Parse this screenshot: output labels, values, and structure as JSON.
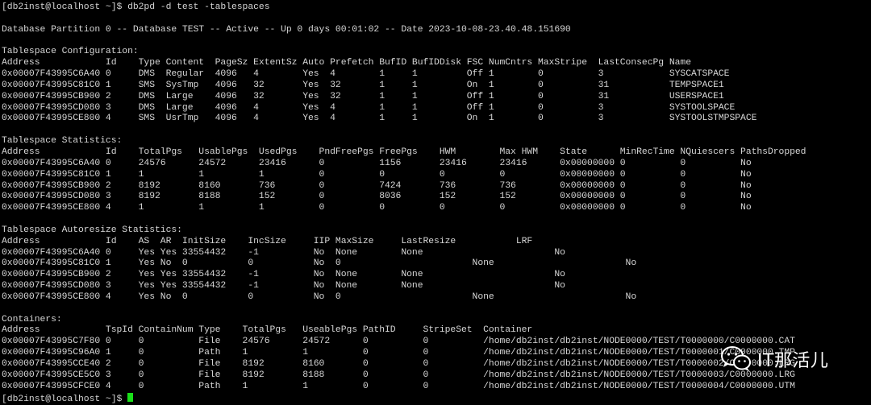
{
  "terminal": {
    "lines": [
      "[db2inst@localhost ~]$ db2pd -d test -tablespaces",
      "",
      "Database Partition 0 -- Database TEST -- Active -- Up 0 days 00:01:02 -- Date 2023-10-08-23.40.48.151690",
      "",
      "Tablespace Configuration:",
      "Address            Id    Type Content  PageSz ExtentSz Auto Prefetch BufID BufIDDisk FSC NumCntrs MaxStripe  LastConsecPg Name",
      "0x00007F43995C6A40 0     DMS  Regular  4096   4        Yes  4        1     1         Off 1        0          3            SYSCATSPACE",
      "0x00007F43995C81C0 1     SMS  SysTmp   4096   32       Yes  32       1     1         On  1        0          31           TEMPSPACE1",
      "0x00007F43995CB900 2     DMS  Large    4096   32       Yes  32       1     1         Off 1        0          31           USERSPACE1",
      "0x00007F43995CD080 3     DMS  Large    4096   4        Yes  4        1     1         Off 1        0          3            SYSTOOLSPACE",
      "0x00007F43995CE800 4     SMS  UsrTmp   4096   4        Yes  4        1     1         On  1        0          3            SYSTOOLSTMPSPACE",
      "",
      "Tablespace Statistics:",
      "Address            Id    TotalPgs   UsablePgs  UsedPgs    PndFreePgs FreePgs    HWM        Max HWM    State      MinRecTime NQuiescers PathsDropped",
      "0x00007F43995C6A40 0     24576      24572      23416      0          1156       23416      23416      0x00000000 0          0          No",
      "0x00007F43995C81C0 1     1          1          1          0          0          0          0          0x00000000 0          0          No",
      "0x00007F43995CB900 2     8192       8160       736        0          7424       736        736        0x00000000 0          0          No",
      "0x00007F43995CD080 3     8192       8188       152        0          8036       152        152        0x00000000 0          0          No",
      "0x00007F43995CE800 4     1          1          1          0          0          0          0          0x00000000 0          0          No",
      "",
      "Tablespace Autoresize Statistics:",
      "Address            Id    AS  AR  InitSize    IncSize     IIP MaxSize     LastResize           LRF",
      "0x00007F43995C6A40 0     Yes Yes 33554432    -1          No  None        None                        No",
      "0x00007F43995C81C0 1     Yes No  0           0           No  0                        None                        No",
      "0x00007F43995CB900 2     Yes Yes 33554432    -1          No  None        None                        No",
      "0x00007F43995CD080 3     Yes Yes 33554432    -1          No  None        None                        No",
      "0x00007F43995CE800 4     Yes No  0           0           No  0                        None                        No",
      "",
      "Containers:",
      "Address            TspId ContainNum Type    TotalPgs   UseablePgs PathID     StripeSet  Container",
      "0x00007F43995C7F80 0     0          File    24576      24572      0          0          /home/db2inst/db2inst/NODE0000/TEST/T0000000/C0000000.CAT",
      "0x00007F43995C96A0 1     0          Path    1          1          0          0          /home/db2inst/db2inst/NODE0000/TEST/T0000001/C0000000.TMP",
      "0x00007F43995CCE40 2     0          File    8192       8160       0          0          /home/db2inst/db2inst/NODE0000/TEST/T0000002/C0000000.LRG",
      "0x00007F43995CE5C0 3     0          File    8192       8188       0          0          /home/db2inst/db2inst/NODE0000/TEST/T0000003/C0000000.LRG",
      "0x00007F43995CFCE0 4     0          Path    1          1          0          0          /home/db2inst/db2inst/NODE0000/TEST/T0000004/C0000000.UTM",
      "[db2inst@localhost ~]$ "
    ]
  },
  "watermark": {
    "text": "IT那活儿",
    "icon": "wechat-icon"
  }
}
